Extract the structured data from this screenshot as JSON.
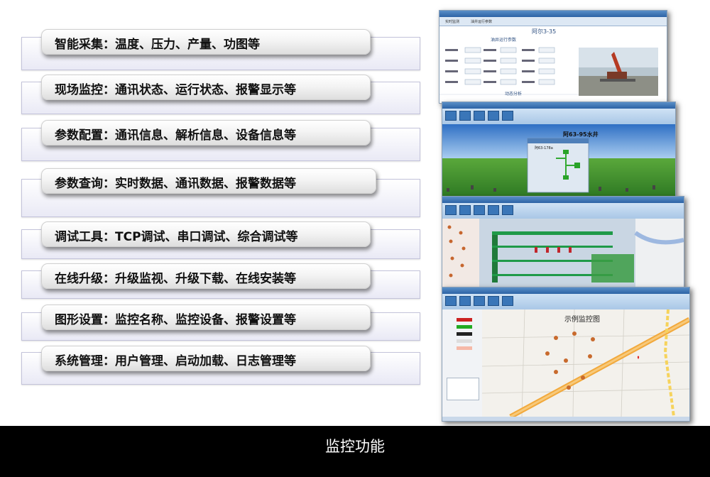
{
  "features": [
    {
      "label": "智能采集：温度、压力、产量、功图等"
    },
    {
      "label": "现场监控：通讯状态、运行状态、报警显示等"
    },
    {
      "label": "参数配置：通讯信息、解析信息、设备信息等"
    },
    {
      "label": "参数查询：实时数据、通讯数据、报警数据等"
    },
    {
      "label": "调试工具：TCP调试、串口调试、综合调试等"
    },
    {
      "label": "在线升级：升级监视、升级下载、在线安装等"
    },
    {
      "label": "图形设置：监控名称、监控设备、报警设置等"
    },
    {
      "label": "系统管理：用户管理、启动加载、日志管理等"
    }
  ],
  "caption": "监控功能",
  "shots": {
    "s1": {
      "tab1": "实时监测",
      "tab2": "油井运行参数",
      "well": "阿尔3-35",
      "heading": "油井运行参数",
      "section": "动态分析"
    },
    "s2": {
      "title": "阿63-95水井",
      "box": "阿63-178a"
    },
    "s4": {
      "title": "示例监控图"
    }
  },
  "colors": {
    "accent": "#2d63a5",
    "map_road": "#f2a93c",
    "field_green": "#3f8f2c",
    "sky": "#3f7fd0"
  }
}
